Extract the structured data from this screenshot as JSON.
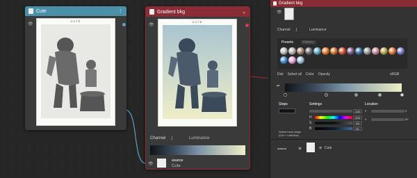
{
  "node1": {
    "title": "Cute",
    "caption": "CUTE"
  },
  "node2": {
    "title": "Gradient bkg",
    "caption": "CUTE",
    "channel_label": "Channel",
    "channel_mode": "Luminance",
    "source_label": "source",
    "source_value": "Cute"
  },
  "panel": {
    "title": "Gradient bkg",
    "channel_label": "Channel",
    "channel_mode": "Luminance",
    "tabs": [
      "Presets",
      "History"
    ],
    "preset_colors": [
      "#bdbdbd",
      "#b5b5b5",
      "#9e7f6b",
      "#6f6f6f",
      "#5fa8c8",
      "#e87a2d",
      "#c8782e",
      "#d84e2e",
      "#7a5a8a",
      "#3a72a8",
      "#9a9a9a",
      "#c98a9e",
      "#b3a54a",
      "#e37834",
      "#7a7ac8",
      "#3e8ad8",
      "#e8a4d8",
      "#9bbfd8"
    ],
    "toolbar": [
      "Dist",
      "Select all",
      "Color",
      "Opacity",
      "sRGB"
    ],
    "stops_label": "Stops",
    "settings_label": "Settings",
    "location_label": "Location",
    "settings_value1": "100",
    "settings_r": "209",
    "settings_g": "53",
    "settings_b": "51",
    "location_value": "0",
    "location_value2": "50",
    "hint": "Select more stops (Ctrl + LeftClick)",
    "source_label": "source",
    "source_value": "Cute",
    "gradient_colors": [
      "#101418",
      "#3a4a5a",
      "#7a92a6",
      "#b8c4b8",
      "#eeedc8"
    ],
    "accent": "#8a2c36"
  }
}
